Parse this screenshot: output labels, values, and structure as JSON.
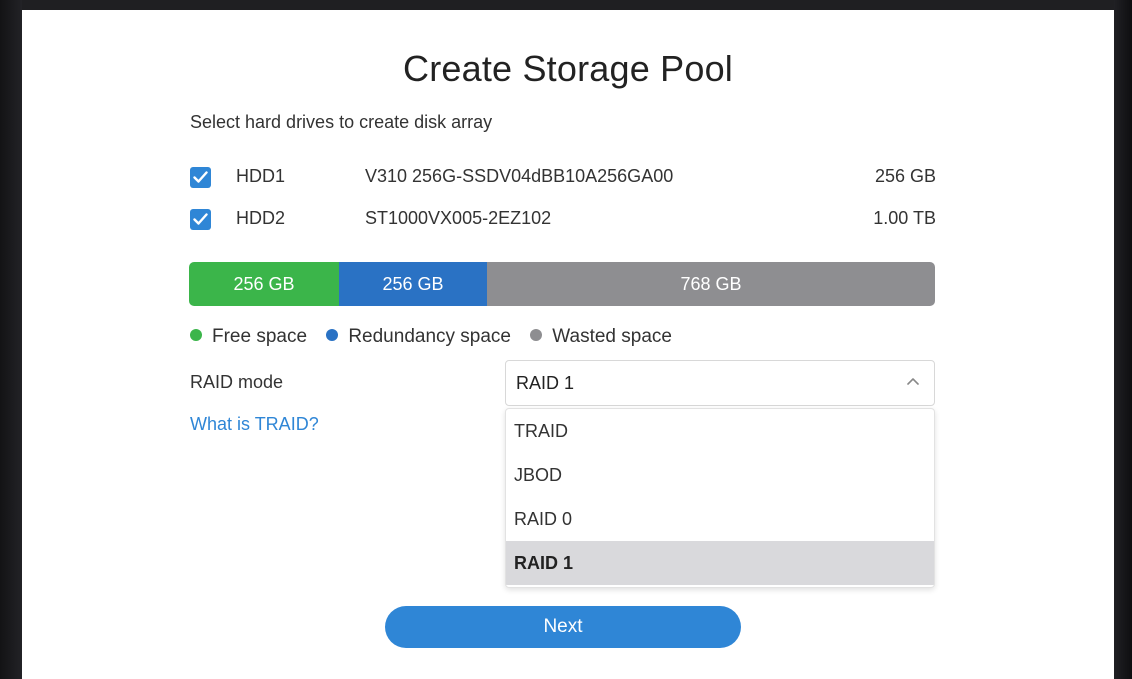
{
  "dialog": {
    "title": "Create Storage Pool",
    "subtitle": "Select hard drives to create disk array"
  },
  "drives": [
    {
      "checked": true,
      "name": "HDD1",
      "model": "V310 256G-SSDV04dBB10A256GA00",
      "size": "256 GB"
    },
    {
      "checked": true,
      "name": "HDD2",
      "model": "ST1000VX005-2EZ102",
      "size": "1.00 TB"
    }
  ],
  "capacity_bar": {
    "free": {
      "label": "256 GB",
      "color": "#3bb54a"
    },
    "redundancy": {
      "label": "256 GB",
      "color": "#2a72c4"
    },
    "wasted": {
      "label": "768 GB",
      "color": "#8e8e91"
    }
  },
  "legend": {
    "free": "Free space",
    "redundancy": "Redundancy space",
    "wasted": "Wasted space"
  },
  "raid": {
    "label": "RAID mode",
    "selected": "RAID 1",
    "help_link": "What is TRAID?",
    "options": [
      "TRAID",
      "JBOD",
      "RAID 0",
      "RAID 1"
    ]
  },
  "next_button": "Next",
  "colors": {
    "accent": "#2f86d6",
    "free": "#3bb54a",
    "redundancy": "#2a72c4",
    "wasted": "#8e8e91"
  }
}
